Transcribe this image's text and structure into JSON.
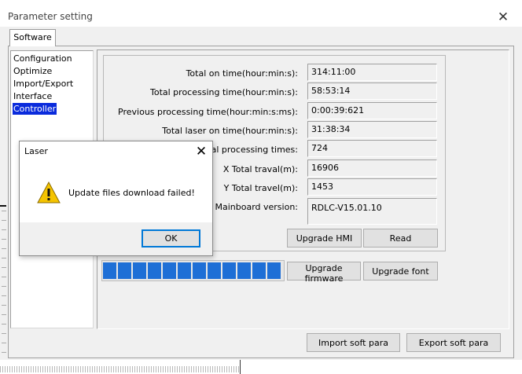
{
  "window": {
    "title": "Parameter setting"
  },
  "tabs": [
    {
      "label": "Software"
    }
  ],
  "sidebar": {
    "items": [
      {
        "label": "Configuration"
      },
      {
        "label": "Optimize"
      },
      {
        "label": "Import/Export"
      },
      {
        "label": "Interface"
      },
      {
        "label": "Controller",
        "selected": true
      }
    ]
  },
  "fields": [
    {
      "label": "Total on time(hour:min:s):",
      "value": "314:11:00"
    },
    {
      "label": "Total processing time(hour:min:s):",
      "value": "58:53:14"
    },
    {
      "label": "Previous processing time(hour:min:s:ms):",
      "value": "0:00:39:621"
    },
    {
      "label": "Total laser on time(hour:min:s):",
      "value": "31:38:34"
    },
    {
      "label": "Total processing times:",
      "value": "724"
    },
    {
      "label": "X Total traval(m):",
      "value": "16906"
    },
    {
      "label": "Y Total travel(m):",
      "value": "1453"
    },
    {
      "label": "Mainboard version:",
      "value": "RDLC-V15.01.10"
    }
  ],
  "buttons": {
    "upgrade_hmi": "Upgrade HMI",
    "read": "Read",
    "upgrade_firmware": "Upgrade firmware",
    "upgrade_font": "Upgrade font",
    "import_soft_para": "Import soft para",
    "export_soft_para": "Export soft para"
  },
  "progress": {
    "value": 1.0,
    "color": "#1e6fd6"
  },
  "dialog": {
    "title": "Laser",
    "message": "Update files download failed!",
    "ok": "OK",
    "icon": "warning-icon"
  },
  "colors": {
    "selection": "#0a2bdc",
    "progress": "#1e6fd6",
    "warning": "#f5c400"
  }
}
